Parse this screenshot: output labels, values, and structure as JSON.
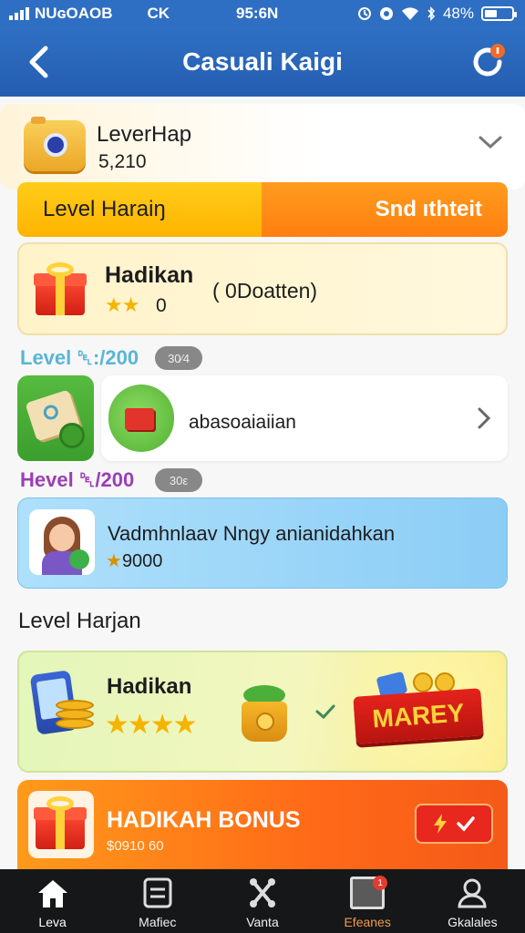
{
  "status_bar": {
    "carrier": "NUɢOAOB",
    "network": "CK",
    "time": "95:6N",
    "battery_text": "48%"
  },
  "header": {
    "title": "Casuali Kaigi"
  },
  "row1": {
    "title": "LeverHap",
    "value": "5,210"
  },
  "tabs": [
    {
      "label": "Level Haraiŋ"
    },
    {
      "label": "Snd ıthteit"
    }
  ],
  "gift_card": {
    "name": "Hadikan",
    "stars": "★★",
    "count": "0",
    "note": "( 0Doatten)"
  },
  "level1": {
    "label": "Level ␡:/200",
    "pill": "30⁄4"
  },
  "item_row": {
    "name": "abasoaiaiian"
  },
  "level2": {
    "label": "Hevel ␡/200",
    "pill": "30ε"
  },
  "blue_card": {
    "name": "Vadmhnlaav Nngy anianidahkan",
    "star": "★",
    "value": "9000"
  },
  "section": {
    "title": "Level Harjan"
  },
  "big_card": {
    "name": "Hadikan",
    "stars": "★★★★",
    "banner": "MAREY"
  },
  "bonus_card": {
    "name": "HADIKAH BONUS",
    "sub": "$0910 60"
  },
  "nav": [
    {
      "label": "Leva"
    },
    {
      "label": "Mafiec"
    },
    {
      "label": "Vanta"
    },
    {
      "label": "Efeanes",
      "badge": "1"
    },
    {
      "label": "Gkalales"
    }
  ],
  "colors": {
    "header": "#2f70c4",
    "tab_left": "#ffc20e",
    "tab_right": "#ff8a14",
    "blue_card": "#9cd6f8",
    "bonus": "#ff7a18",
    "nav_bg": "#161718"
  }
}
